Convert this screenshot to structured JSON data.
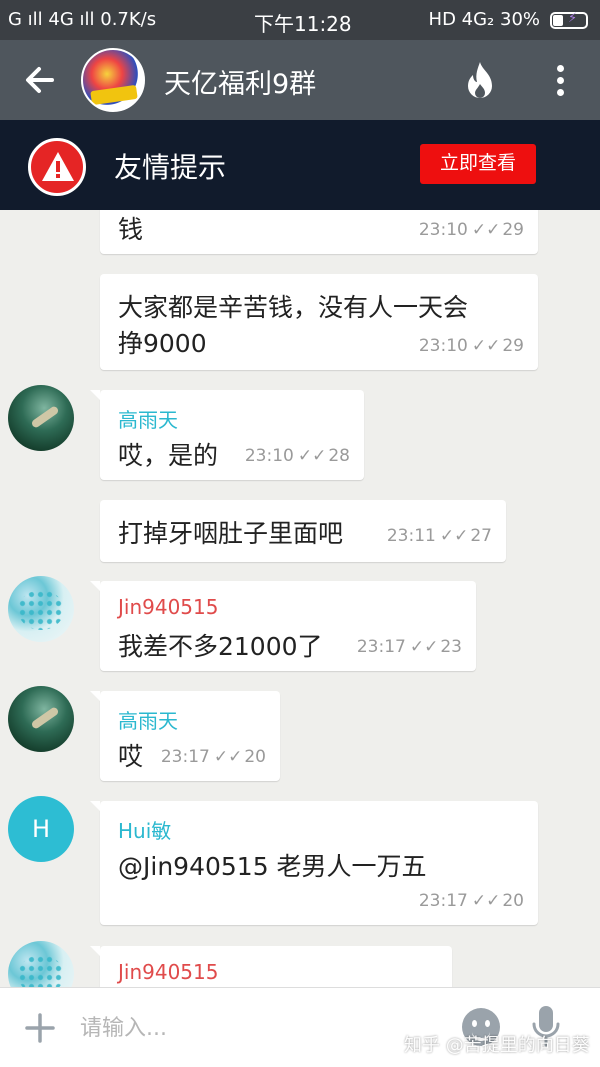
{
  "status_bar": {
    "left": "G ıll 4G ıll 0.7K/s",
    "time": "下午11:28",
    "right": "HD 4G₂ 30%"
  },
  "header": {
    "title": "天亿福利9群",
    "back_icon": "back-arrow-icon",
    "fire_icon": "fire-icon",
    "more_icon": "more-vertical-icon"
  },
  "notice": {
    "text": "友情提示",
    "button": "立即查看",
    "icon": "warning-icon"
  },
  "messages": [
    {
      "text": "钱",
      "time": "23:10",
      "views": "29"
    },
    {
      "text_line1": "大家都是辛苦钱，没有人一天会",
      "text_line2": "挣9000",
      "time": "23:10",
      "views": "29"
    },
    {
      "sender": "高雨天",
      "sender_color": "#2bb8cf",
      "text": "哎，是的",
      "time": "23:10",
      "views": "28"
    },
    {
      "text": "打掉牙咽肚子里面吧",
      "time": "23:11",
      "views": "27"
    },
    {
      "sender": "Jin940515",
      "sender_color": "#e04b4b",
      "text": "我差不多21000了",
      "time": "23:17",
      "views": "23"
    },
    {
      "sender": "高雨天",
      "sender_color": "#2bb8cf",
      "text": "哎",
      "time": "23:17",
      "views": "20"
    },
    {
      "sender": "Hui敏",
      "sender_color": "#2bb8cf",
      "avatar_letter": "H",
      "text": "@Jin940515 老男人一万五",
      "time": "23:17",
      "views": "20"
    },
    {
      "sender": "Jin940515",
      "sender_color": "#e04b4b"
    }
  ],
  "input": {
    "placeholder": "请输入..."
  },
  "watermark": "知乎 @苦提里的向日葵"
}
